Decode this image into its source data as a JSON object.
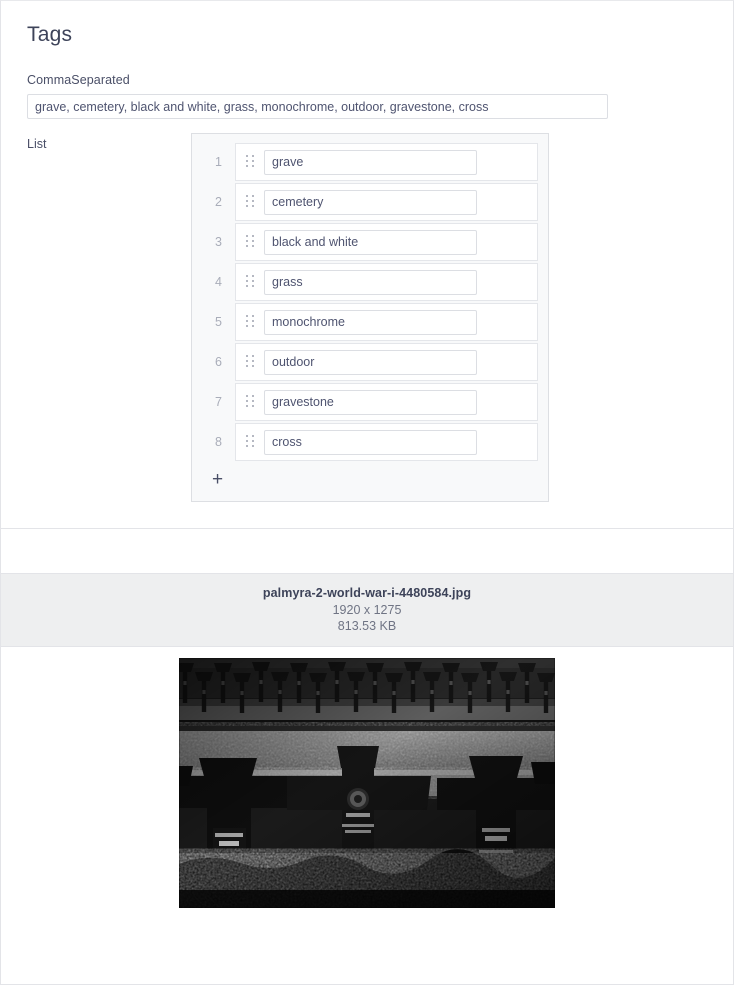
{
  "panel": {
    "title": "Tags",
    "comma_separated": {
      "label": "CommaSeparated",
      "value": "grave, cemetery, black and white, grass, monochrome, outdoor, gravestone, cross",
      "placeholder": ""
    },
    "list": {
      "label": "List",
      "add_label": "+",
      "items": [
        {
          "index": "1",
          "value": "grave"
        },
        {
          "index": "2",
          "value": "cemetery"
        },
        {
          "index": "3",
          "value": "black and white"
        },
        {
          "index": "4",
          "value": "grass"
        },
        {
          "index": "5",
          "value": "monochrome"
        },
        {
          "index": "6",
          "value": "outdoor"
        },
        {
          "index": "7",
          "value": "gravestone"
        },
        {
          "index": "8",
          "value": "cross"
        }
      ]
    }
  },
  "file": {
    "name": "palmyra-2-world-war-i-4480584.jpg",
    "dimensions": "1920 x 1275",
    "size": "813.53 KB"
  },
  "preview": {
    "alt": "Black and white photograph of a World War I military cemetery with rows of stone crosses"
  },
  "colors": {
    "text": "#3d4359",
    "muted": "#6f7484",
    "index": "#a9adb9",
    "border": "#dcdee3",
    "panel_bg": "#f8f9fa",
    "file_band_bg": "#eeeff0"
  }
}
